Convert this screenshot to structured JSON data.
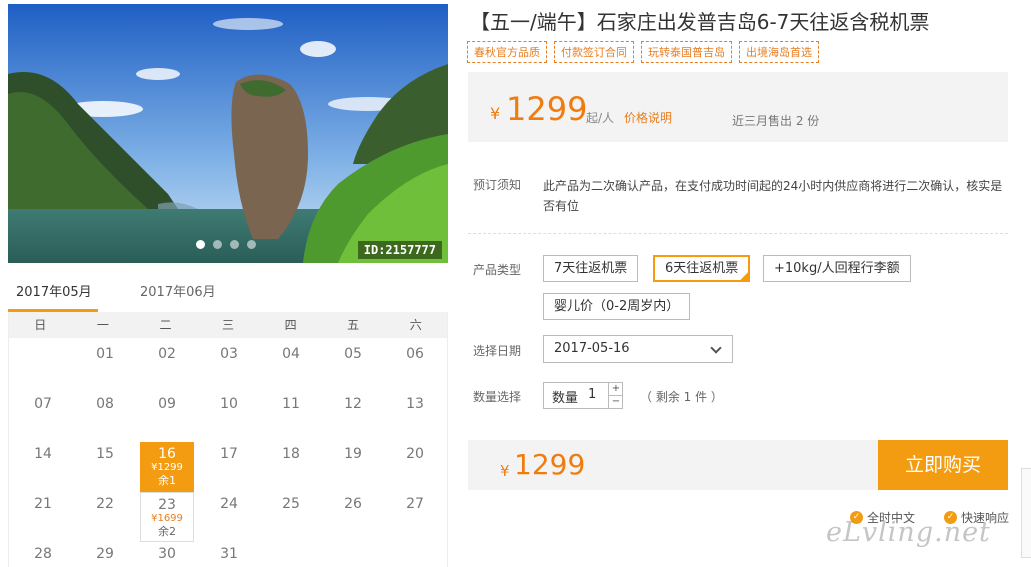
{
  "photo": {
    "id_label": "ID:2157777",
    "slides": 4,
    "active_slide": 1
  },
  "calendar": {
    "tabs": [
      "2017年05月",
      "2017年06月"
    ],
    "weekdays": [
      "日",
      "一",
      "二",
      "三",
      "四",
      "五",
      "六"
    ],
    "days": [
      {
        "d": ""
      },
      {
        "d": "01"
      },
      {
        "d": "02"
      },
      {
        "d": "03"
      },
      {
        "d": "04"
      },
      {
        "d": "05"
      },
      {
        "d": "06"
      },
      {
        "d": "07"
      },
      {
        "d": "08"
      },
      {
        "d": "09"
      },
      {
        "d": "10"
      },
      {
        "d": "11"
      },
      {
        "d": "12"
      },
      {
        "d": "13"
      },
      {
        "d": "14"
      },
      {
        "d": "15"
      },
      {
        "d": "16",
        "price": "¥1299",
        "stock": "余1",
        "state": "selected"
      },
      {
        "d": "17"
      },
      {
        "d": "18"
      },
      {
        "d": "19"
      },
      {
        "d": "20"
      },
      {
        "d": "21"
      },
      {
        "d": "22"
      },
      {
        "d": "23",
        "price": "¥1699",
        "stock": "余2",
        "state": "available"
      },
      {
        "d": "24"
      },
      {
        "d": "25"
      },
      {
        "d": "26"
      },
      {
        "d": "27"
      },
      {
        "d": "28"
      },
      {
        "d": "29"
      },
      {
        "d": "30"
      },
      {
        "d": "31"
      }
    ]
  },
  "product": {
    "title": "【五一/端午】石家庄出发普吉岛6-7天往返含税机票",
    "tags": [
      "春秋官方品质",
      "付款签订合同",
      "玩转泰国普吉岛",
      "出境海岛首选"
    ],
    "currency": "¥",
    "price": "1299",
    "unit": "起/人",
    "price_explain": "价格说明",
    "sold": "近三月售出 2 份",
    "notice_label": "预订须知",
    "notice_text": "此产品为二次确认产品，在支付成功时间起的24小时内供应商将进行二次确认，核实是否有位",
    "type_label": "产品类型",
    "types": [
      "7天往返机票",
      "6天往返机票",
      "+10kg/人回程行李额",
      "婴儿价（0-2周岁内）"
    ],
    "selected_type": 1,
    "date_label": "选择日期",
    "date_value": "2017-05-16",
    "qty_label": "数量选择",
    "qty_field_label": "数量",
    "qty_value": "1",
    "qty_plus": "+",
    "qty_minus": "−",
    "stock_note": "（ 剩余 1 件 ）",
    "total_price": "1299",
    "buy_label": "立即购买",
    "badges": [
      "全时中文",
      "快速响应"
    ]
  },
  "watermark": "eLvling.net",
  "colors": {
    "accent": "#f39c12",
    "price": "#f07c10"
  }
}
